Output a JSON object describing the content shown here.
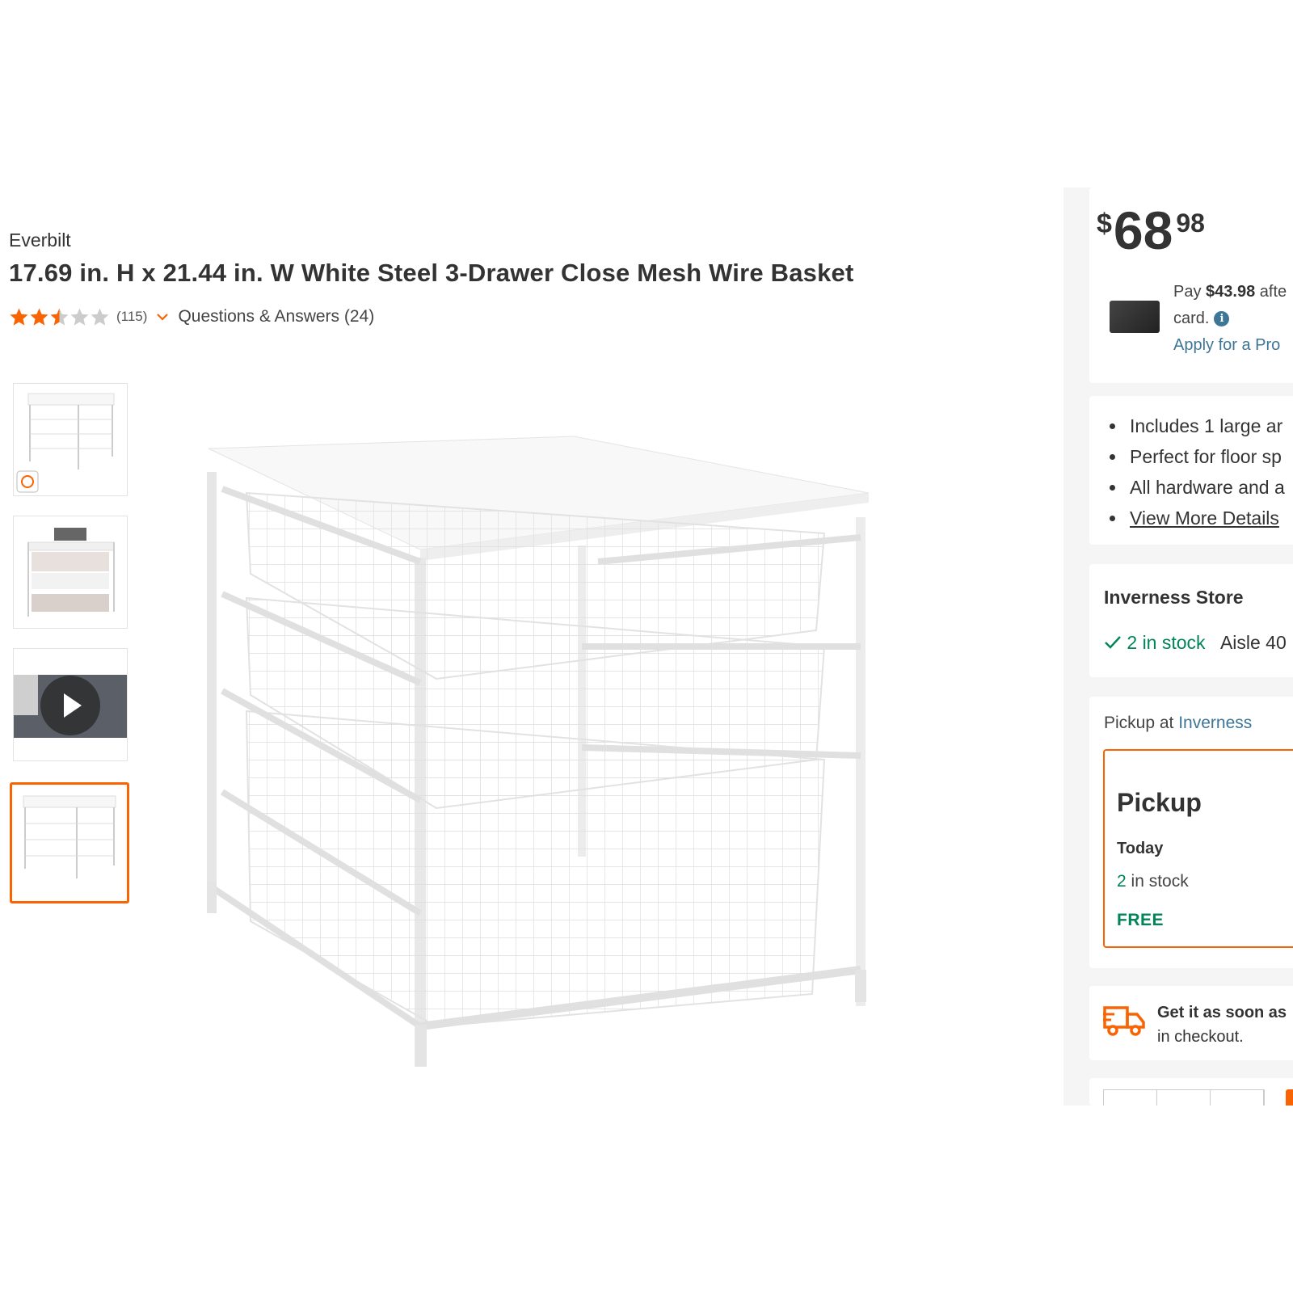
{
  "product": {
    "brand": "Everbilt",
    "title": "17.69 in. H x 21.44 in. W White Steel 3-Drawer Close Mesh Wire Basket",
    "rating": 2.5,
    "rating_max": 5,
    "review_count": "(115)",
    "qa_label": "Questions & Answers (24)"
  },
  "gallery": {
    "thumbnails": [
      "thumb-product-front",
      "thumb-product-styled",
      "thumb-video",
      "thumb-product-selected"
    ],
    "selected_index": 3
  },
  "price": {
    "currency": "$",
    "dollars": "68",
    "cents": "98"
  },
  "promo": {
    "line1_pre": "Pay ",
    "line1_amount": "$43.98",
    "line1_post": " afte",
    "line2": "card.",
    "info_icon": "i",
    "apply_link": "Apply for a Pro"
  },
  "highlights": {
    "items": [
      "Includes 1 large ar",
      "Perfect for floor sp",
      "All hardware and a"
    ],
    "more_link": "View More Details"
  },
  "store": {
    "name": "Inverness Store",
    "stock": "2 in stock",
    "aisle": "Aisle 40"
  },
  "fulfillment": {
    "pickup_at_label": "Pickup at ",
    "pickup_store": "Inverness",
    "option_title": "Pickup",
    "when": "Today",
    "stock_num": "2",
    "stock_suffix": " in stock",
    "cost": "FREE"
  },
  "delivery": {
    "line1": "Get it as soon as",
    "line2": "in checkout."
  },
  "colors": {
    "accent": "#f96302",
    "stock_green": "#00855a",
    "link_blue": "#3e7697",
    "star": "#f96302"
  }
}
